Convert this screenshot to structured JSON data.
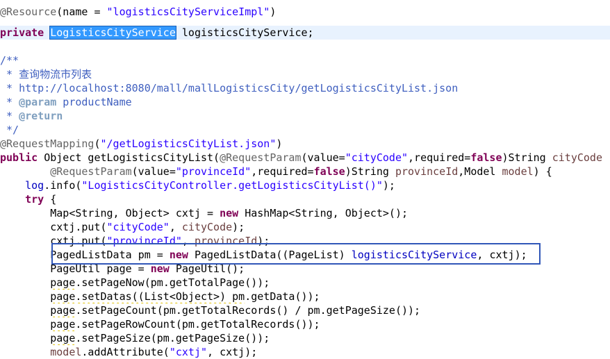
{
  "code": {
    "l1": {
      "a": "@Resource",
      "b": "(name = ",
      "c": "\"logisticsCityServiceImpl\"",
      "d": ")"
    },
    "l2": {
      "kw": "private",
      "sp": " ",
      "sel": "LogisticsCityService",
      "rest": " logisticsCityService;"
    },
    "l4": {
      "text": "/**"
    },
    "l5": {
      "star": " * ",
      "cn": "查询物流市列表"
    },
    "l6": {
      "text": " * http://localhost:8080/mall/mallLogisticsCity/getLogisticsCityList.json"
    },
    "l7": {
      "star": " * ",
      "tag": "@param",
      "rest": " productName"
    },
    "l8": {
      "star": " * ",
      "tag": "@return"
    },
    "l9": {
      "text": " */"
    },
    "l10": {
      "a": "@RequestMapping",
      "b": "(",
      "c": "\"/getLogisticsCityList.json\"",
      "d": ")"
    },
    "l11": {
      "kw": "public",
      "t1": " Object getLogisticsCityList(",
      "ann": "@RequestParam",
      "t2": "(value=",
      "s1": "\"cityCode\"",
      "t3": ",required=",
      "kw2": "false",
      "t4": ")String ",
      "p1": "cityCode"
    },
    "l12": {
      "indent": "        ",
      "ann": "@RequestParam",
      "t1": "(value=",
      "s1": "\"provinceId\"",
      "t2": ",required=",
      "kw": "false",
      "t3": ")String ",
      "p1": "provinceId",
      "t4": ",Model ",
      "p2": "model",
      "t5": ") {"
    },
    "l13": {
      "indent": "    ",
      "f": "log",
      "t1": ".info(",
      "s1": "\"LogisticsCityController.getLogisticsCityList()\"",
      "t2": ");"
    },
    "l14": {
      "indent": "    ",
      "kw": "try",
      "t1": " {"
    },
    "l15": {
      "indent": "        ",
      "t1": "Map<String, Object> ",
      "v": "cxtj",
      "t2": " = ",
      "kw": "new",
      "t3": " HashMap<String, Object>();"
    },
    "l16": {
      "indent": "        ",
      "v": "cxtj",
      "t1": ".put(",
      "s1": "\"cityCode\"",
      "t2": ", ",
      "p": "cityCode",
      "t3": ");"
    },
    "l17": {
      "indent": "        ",
      "v": "cxtj",
      "t1": ".put(",
      "s1": "\"provinceId\"",
      "t2": ", ",
      "p": "provinceId",
      "t3": ");"
    },
    "l18": {
      "indent": "        ",
      "t1": "PagedListData ",
      "v": "pm",
      "t2": " = ",
      "kw": "new",
      "t3": " PagedListData((PageList) ",
      "f": "logisticsCityService",
      "t4": ", ",
      "v2": "cxtj",
      "t5": ");"
    },
    "l19": {
      "indent": "        ",
      "t1": "PageUtil ",
      "v": "page",
      "t2": " = ",
      "kw": "new",
      "t3": " PageUtil();"
    },
    "l20": {
      "indent": "        ",
      "v": "page",
      "t1": ".setPageNow(",
      "v2": "pm",
      "t2": ".getTotalPage());"
    },
    "l21": {
      "indent": "        ",
      "v": "page",
      "t1": ".setDatas((List<Object>) ",
      "v2": "pm",
      "t2": ".getData());"
    },
    "l22": {
      "indent": "        ",
      "v": "page",
      "t1": ".setPageCount(",
      "v2": "pm",
      "t2": ".getTotalRecords() / ",
      "v3": "pm",
      "t3": ".getPageSize());"
    },
    "l23": {
      "indent": "        ",
      "v": "page",
      "t1": ".setPageRowCount(",
      "v2": "pm",
      "t2": ".getTotalRecords());"
    },
    "l24": {
      "indent": "        ",
      "v": "page",
      "t1": ".setPageSize(",
      "v2": "pm",
      "t2": ".getPageSize());"
    },
    "l25": {
      "indent": "        ",
      "p": "model",
      "t1": ".addAttribute(",
      "s1": "\"cxtj\"",
      "t2": ", ",
      "v": "cxtj",
      "t3": ");"
    }
  },
  "colors": {
    "annotation": "#646464",
    "string": "#2a00ff",
    "keyword": "#7f0055",
    "comment": "#3f5fbf",
    "javadoc_tag": "#7f9fbf",
    "field": "#0000c0",
    "parameter": "#6a3e3e",
    "selection": "#3399ff",
    "current_line": "#e8f2fe",
    "highlight_box": "#3056b8"
  }
}
